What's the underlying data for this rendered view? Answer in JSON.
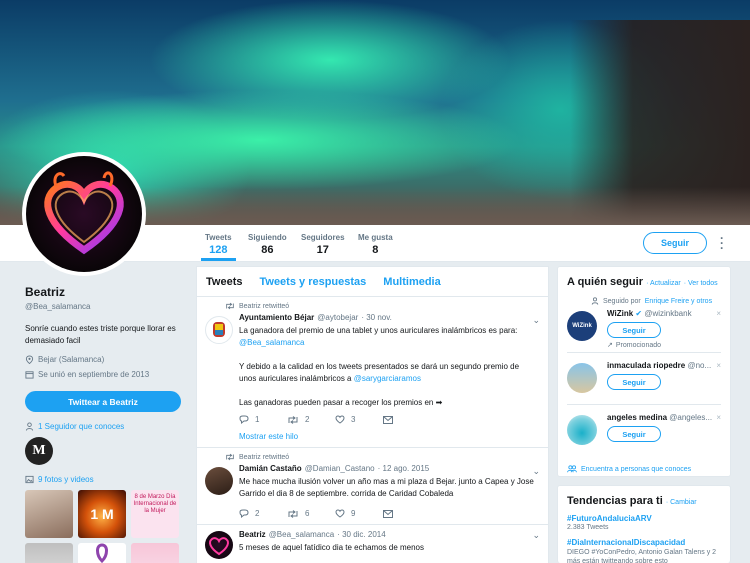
{
  "banner": {
    "description_icon": "aurora-banner"
  },
  "profile_nav": {
    "stats": [
      {
        "label": "Tweets",
        "value": "128"
      },
      {
        "label": "Siguiendo",
        "value": "86"
      },
      {
        "label": "Seguidores",
        "value": "17"
      },
      {
        "label": "Me gusta",
        "value": "8"
      }
    ],
    "follow_label": "Seguir",
    "more_icon": "more-vertical-icon"
  },
  "profile": {
    "name": "Beatriz",
    "handle": "@Bea_salamanca",
    "bio": "Sonríe cuando estes triste porque llorar es demasiado facil",
    "location": "Bejar (Salamanca)",
    "joined": "Se unió en septiembre de 2013",
    "tweet_to_label": "Twittear a Beatriz",
    "known_followers": "1 Seguidor que conoces",
    "known_avatar_letter": "M",
    "media_label": "9 fotos y videos",
    "thumb_texts": {
      "t2": "1 M",
      "t3": "8 de Marzo Día Internacional de la Mujer"
    }
  },
  "timeline": {
    "tabs": [
      "Tweets",
      "Tweets y respuestas",
      "Multimedia"
    ],
    "tweets": [
      {
        "retweeted_by": "Beatriz retwitteó",
        "name": "Ayuntamiento Béjar",
        "handle": "@aytobejar",
        "date": "· 30 nov.",
        "text_a": "La ganadora del premio de una tablet y unos auriculares inalámbricos es para:",
        "mention_a": "@Bea_salamanca",
        "text_b": "Y debido a la calidad en los tweets presentados se dará un segundo premio de unos auriculares inalámbricos a",
        "mention_b": "@sarygarciaramos",
        "text_c": "Las ganadoras pueden pasar a recoger los premios en",
        "replies": "1",
        "retweets": "2",
        "likes": "3",
        "thread_label": "Mostrar este hilo"
      },
      {
        "retweeted_by": "Beatriz retwitteó",
        "name": "Damián Castaño",
        "handle": "@Damian_Castano",
        "date": "· 12 ago. 2015",
        "text": "Me hace mucha ilusión volver un año mas a mi plaza d Bejar. junto a Capea y Jose Garrido el dia 8 de septiembre. corrida de Caridad Cobaleda",
        "replies": "2",
        "retweets": "6",
        "likes": "9"
      },
      {
        "name": "Beatriz",
        "handle": "@Bea_salamanca",
        "date": "· 30 dic. 2014",
        "text": "5 meses de aquel fatídico dia te echamos de menos"
      }
    ]
  },
  "who_to_follow": {
    "title": "A quién seguir",
    "refresh": "· Actualizar",
    "view_all": "· Ver todos",
    "followed_by_prefix": "Seguido por",
    "followed_by_names": "Enrique Freire y otros",
    "accounts": [
      {
        "name": "WiZink",
        "handle": "@wizinkbank",
        "promo": "Promocionado",
        "follow": "Seguir",
        "avatar_text": "WiZink"
      },
      {
        "name": "inmaculada riopedre",
        "handle": "@no...",
        "follow": "Seguir"
      },
      {
        "name": "angeles medina",
        "handle": "@angeles...",
        "follow": "Seguir"
      }
    ],
    "find_people": "Encuentra a personas que conoces"
  },
  "trends": {
    "title": "Tendencias para ti",
    "change": "· Cambiar",
    "items": [
      {
        "name": "#FuturoAndaluciaARV",
        "count": "2.383 Tweets"
      },
      {
        "name": "#DiaInternacionalDiscapacidad",
        "desc": "DIEGO #YoConPedro, Antonio Galan Talens y 2 más están twitteando sobre esto"
      }
    ]
  },
  "colors": {
    "accent": "#1da1f2",
    "text": "#14171a",
    "muted": "#657786",
    "background": "#e6ecf0"
  }
}
